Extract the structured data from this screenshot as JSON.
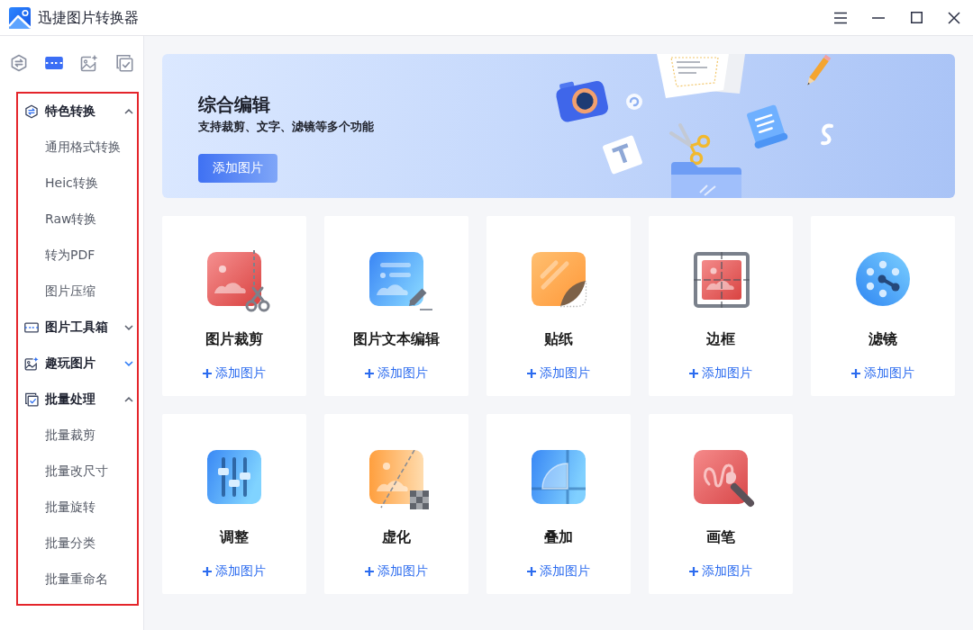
{
  "window": {
    "title": "迅捷图片转换器"
  },
  "sidebar": {
    "tabs": [
      {
        "kind": "convert",
        "selected": false
      },
      {
        "kind": "toolbox",
        "selected": true
      },
      {
        "kind": "fun",
        "selected": false
      },
      {
        "kind": "batch",
        "selected": false
      }
    ],
    "groups": [
      {
        "kind": "convert",
        "label": "特色转换",
        "expanded": true,
        "highlighted": false,
        "items": [
          "通用格式转换",
          "Heic转换",
          "Raw转换",
          "转为PDF",
          "图片压缩"
        ]
      },
      {
        "kind": "toolbox",
        "label": "图片工具箱",
        "expanded": false,
        "highlighted": false
      },
      {
        "kind": "fun",
        "label": "趣玩图片",
        "expanded": false,
        "highlighted": true
      },
      {
        "kind": "batch",
        "label": "批量处理",
        "expanded": true,
        "highlighted": false,
        "items": [
          "批量裁剪",
          "批量改尺寸",
          "批量旋转",
          "批量分类",
          "批量重命名"
        ]
      }
    ]
  },
  "banner": {
    "title": "综合编辑",
    "subtitle": "支持裁剪、文字、滤镜等多个功能",
    "button": "添加图片"
  },
  "tools": [
    {
      "kind": "crop",
      "title": "图片裁剪",
      "action": "添加图片"
    },
    {
      "kind": "text",
      "title": "图片文本编辑",
      "action": "添加图片"
    },
    {
      "kind": "sticker",
      "title": "贴纸",
      "action": "添加图片"
    },
    {
      "kind": "frame",
      "title": "边框",
      "action": "添加图片"
    },
    {
      "kind": "filter",
      "title": "滤镜",
      "action": "添加图片"
    },
    {
      "kind": "adjust",
      "title": "调整",
      "action": "添加图片"
    },
    {
      "kind": "blur",
      "title": "虚化",
      "action": "添加图片"
    },
    {
      "kind": "overlay",
      "title": "叠加",
      "action": "添加图片"
    },
    {
      "kind": "brush",
      "title": "画笔",
      "action": "添加图片"
    }
  ]
}
